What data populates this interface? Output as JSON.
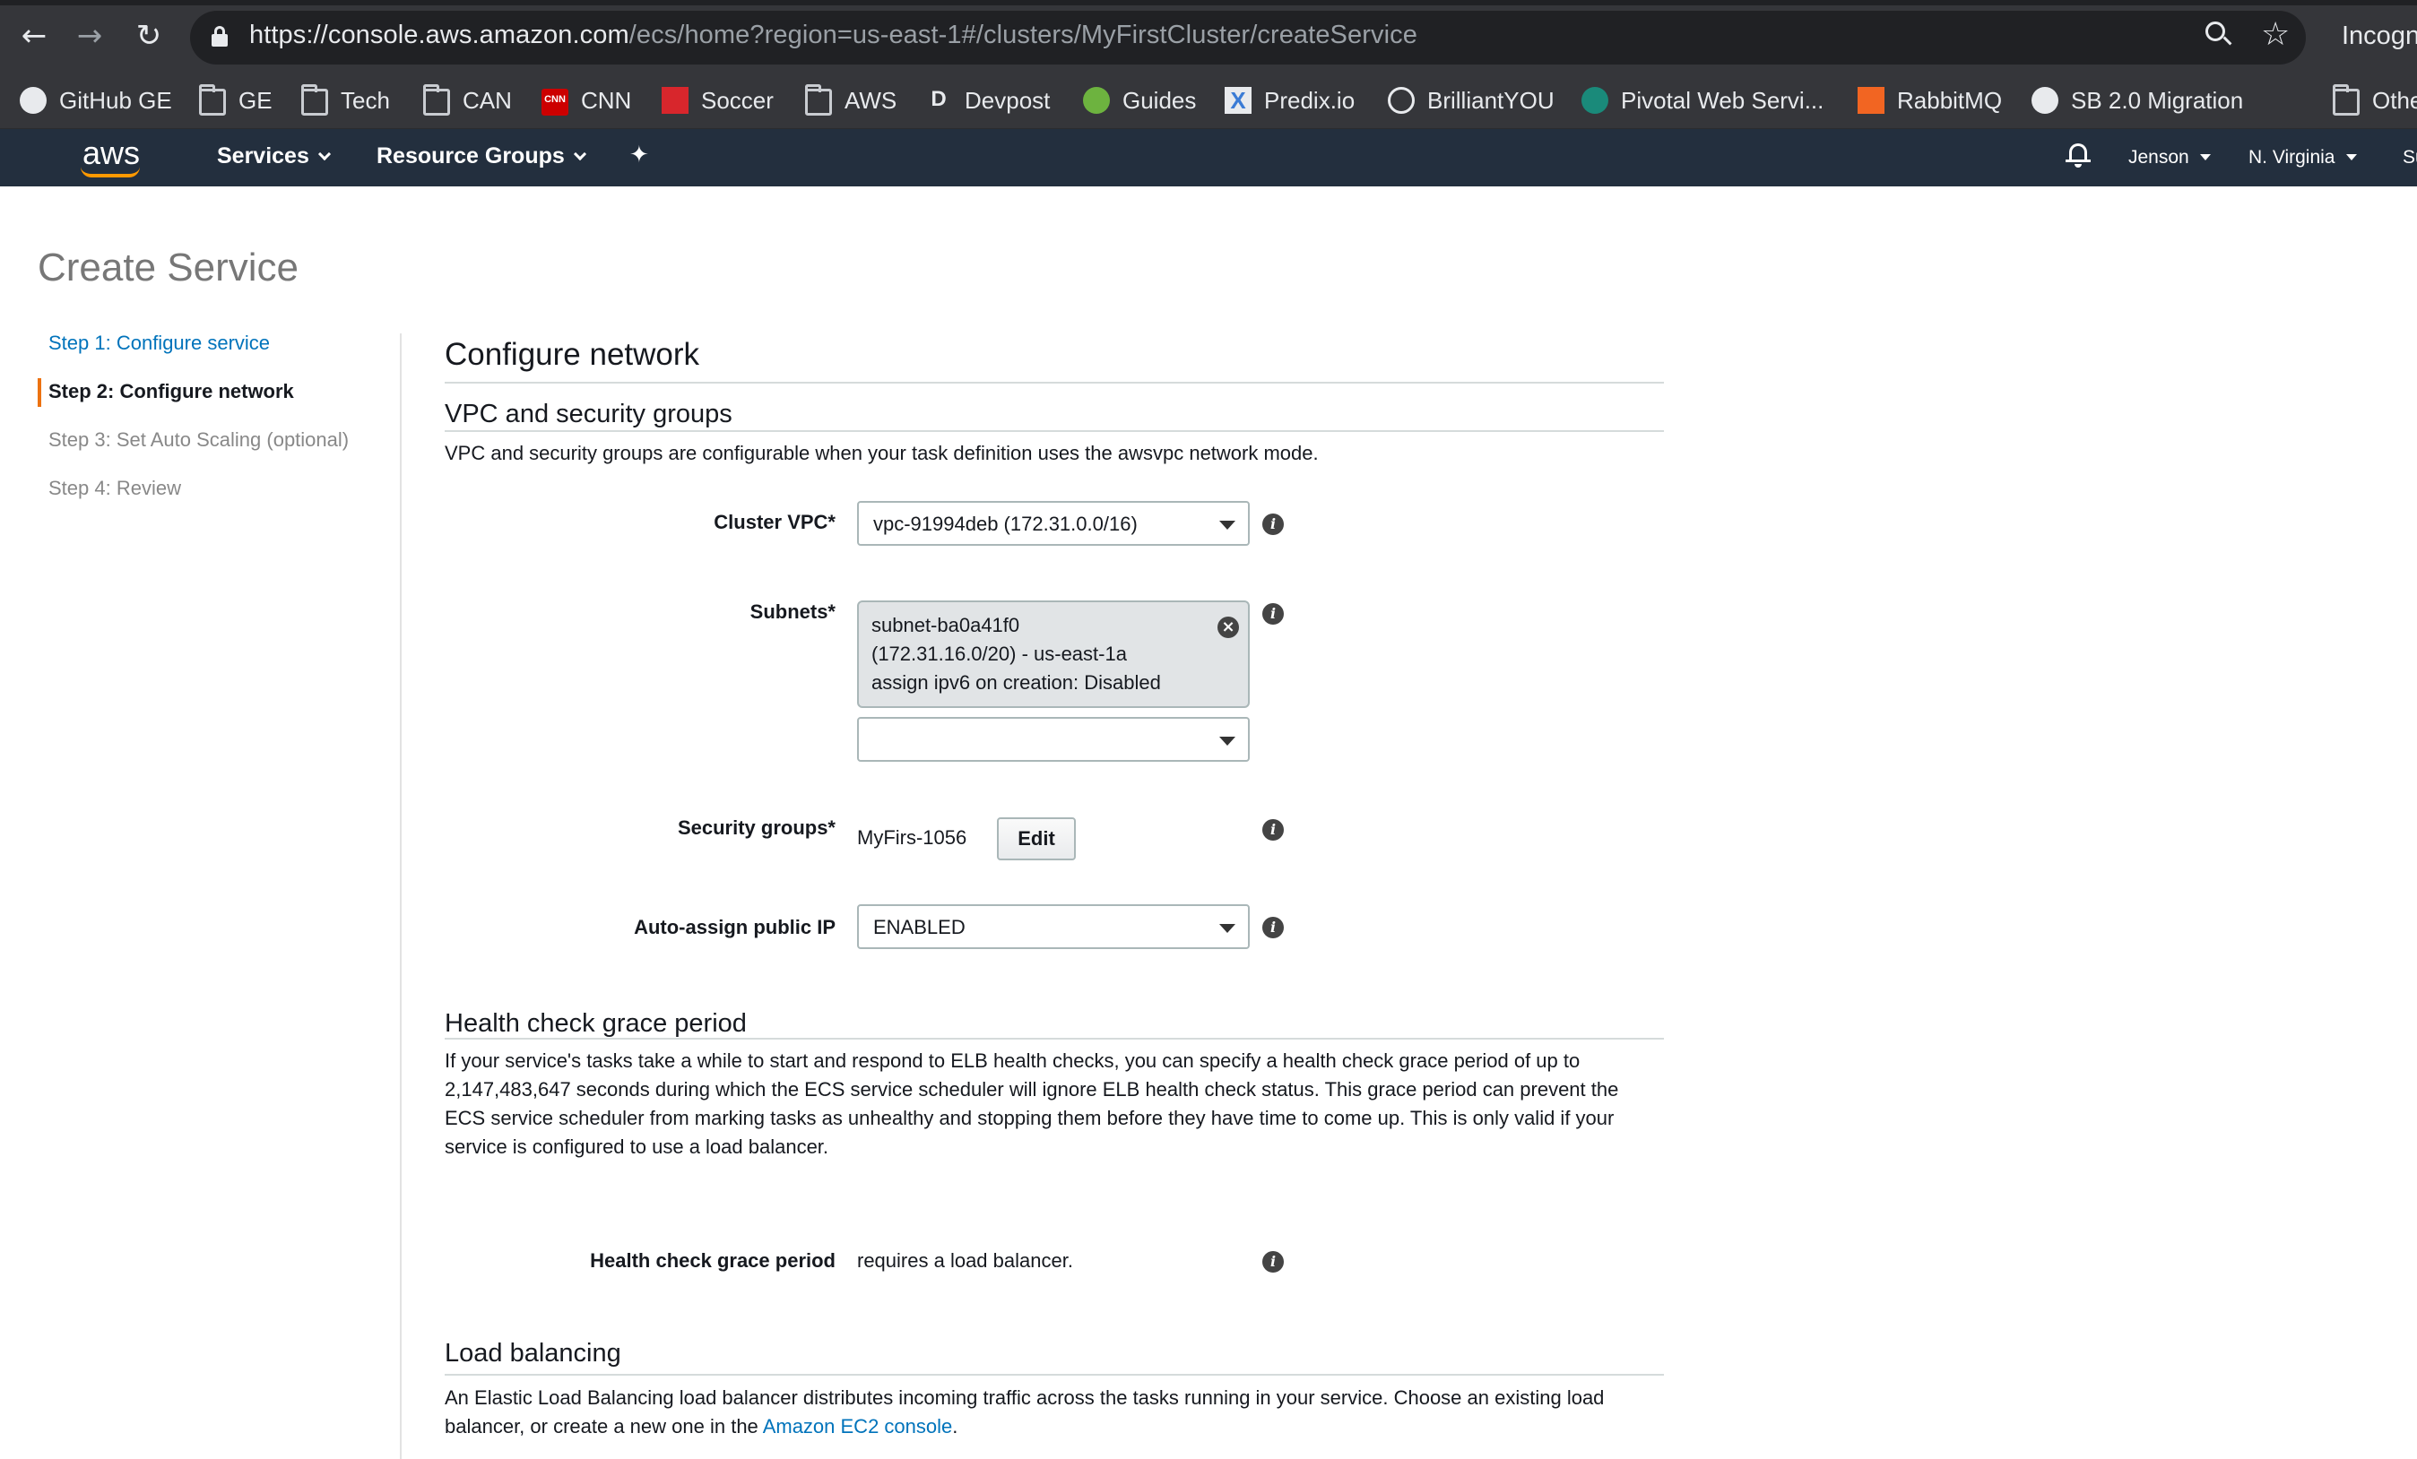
{
  "browser": {
    "url_host": "https://console.aws.amazon.com",
    "url_path": "/ecs/home?region=us-east-1#/clusters/MyFirstCluster/createService",
    "profile_label": "Incogn",
    "bookmarks": [
      {
        "label": "GitHub GE",
        "icon": "github-icon"
      },
      {
        "label": "GE",
        "icon": "folder-icon"
      },
      {
        "label": "Tech",
        "icon": "folder-icon"
      },
      {
        "label": "CAN",
        "icon": "folder-icon"
      },
      {
        "label": "CNN",
        "icon": "cnn-icon"
      },
      {
        "label": "Soccer",
        "icon": "soccer-icon"
      },
      {
        "label": "AWS",
        "icon": "folder-icon"
      },
      {
        "label": "Devpost",
        "icon": "devpost-icon"
      },
      {
        "label": "Guides",
        "icon": "spring-icon"
      },
      {
        "label": "Predix.io",
        "icon": "predix-icon"
      },
      {
        "label": "BrilliantYOU",
        "icon": "globe-icon"
      },
      {
        "label": "Pivotal Web Servi...",
        "icon": "pivotal-icon"
      },
      {
        "label": "RabbitMQ",
        "icon": "rabbitmq-icon"
      },
      {
        "label": "SB 2.0 Migration",
        "icon": "github-icon"
      },
      {
        "label": "Othe",
        "icon": "folder-icon"
      }
    ],
    "cnn_icon_text": "CNN",
    "devpost_icon_text": "D",
    "predix_icon_text": "X"
  },
  "aws_nav": {
    "logo": "aws",
    "services": "Services",
    "resource_groups": "Resource Groups",
    "user": "Jenson",
    "region": "N. Virginia",
    "support": "Su"
  },
  "page": {
    "title": "Create Service",
    "steps": [
      "Step 1: Configure service",
      "Step 2: Configure network",
      "Step 3: Set Auto Scaling (optional)",
      "Step 4: Review"
    ],
    "active_step": 2
  },
  "configure_network": {
    "heading": "Configure network",
    "vpc_section": {
      "heading": "VPC and security groups",
      "description": "VPC and security groups are configurable when your task definition uses the awsvpc network mode.",
      "cluster_vpc_label": "Cluster VPC*",
      "cluster_vpc_value": "vpc-91994deb (172.31.0.0/16)",
      "subnets_label": "Subnets*",
      "subnet_chip": {
        "line1": "subnet-ba0a41f0",
        "line2": "(172.31.16.0/20) - us-east-1a",
        "line3": "assign ipv6 on creation: Disabled"
      },
      "subnet_select_value": "",
      "security_groups_label": "Security groups*",
      "security_groups_value": "MyFirs-1056",
      "edit_label": "Edit",
      "auto_assign_label": "Auto-assign public IP",
      "auto_assign_value": "ENABLED"
    },
    "health_check": {
      "heading": "Health check grace period",
      "description": "If your service's tasks take a while to start and respond to ELB health checks, you can specify a health check grace period of up to 2,147,483,647 seconds during which the ECS service scheduler will ignore ELB health check status. This grace period can prevent the ECS service scheduler from marking tasks as unhealthy and stopping them before they have time to come up. This is only valid if your service is configured to use a load balancer.",
      "field_label": "Health check grace period",
      "field_value": "requires a load balancer."
    },
    "load_balancing": {
      "heading": "Load balancing",
      "description_prefix": "An Elastic Load Balancing load balancer distributes incoming traffic across the tasks running in your service. Choose an existing load balancer, or create a new one in the ",
      "link_text": "Amazon EC2 console",
      "description_suffix": "."
    }
  },
  "colors": {
    "aws_nav_bg": "#232f3e",
    "aws_orange": "#ff9900",
    "link_blue": "#0073bb",
    "active_step_bar": "#ec7211"
  }
}
